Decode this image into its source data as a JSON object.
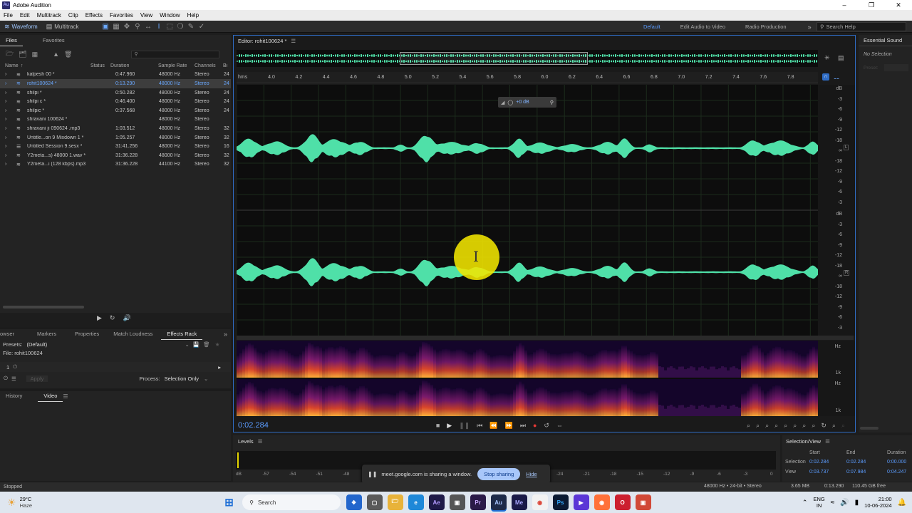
{
  "window": {
    "title": "Adobe Audition",
    "app_icon": "Au"
  },
  "menu": [
    "File",
    "Edit",
    "Multitrack",
    "Clip",
    "Effects",
    "Favorites",
    "View",
    "Window",
    "Help"
  ],
  "toolbar": {
    "waveform": "Waveform",
    "multitrack": "Multitrack",
    "workspaces": [
      "Default",
      "Edit Audio to Video",
      "Radio Production"
    ],
    "search_placeholder": "Search Help"
  },
  "files_panel": {
    "tabs": [
      "Files",
      "Favorites"
    ],
    "columns": [
      "Name",
      "Status",
      "Duration",
      "Sample Rate",
      "Channels",
      "Bi"
    ],
    "rows": [
      {
        "name": "kalpesh 00 *",
        "duration": "0:47.960",
        "rate": "48000 Hz",
        "channels": "Stereo",
        "bits": "24",
        "type": "wave"
      },
      {
        "name": "rohit100624 *",
        "duration": "0:13.290",
        "rate": "48000 Hz",
        "channels": "Stereo",
        "bits": "24",
        "type": "wave",
        "selected": true
      },
      {
        "name": "shilpi *",
        "duration": "0:50.282",
        "rate": "48000 Hz",
        "channels": "Stereo",
        "bits": "24",
        "type": "wave"
      },
      {
        "name": "shilpi c *",
        "duration": "0:46.400",
        "rate": "48000 Hz",
        "channels": "Stereo",
        "bits": "24",
        "type": "wave"
      },
      {
        "name": "shilpic *",
        "duration": "0:37.568",
        "rate": "48000 Hz",
        "channels": "Stereo",
        "bits": "24",
        "type": "wave"
      },
      {
        "name": "shravani 100624 *",
        "duration": "",
        "rate": "48000 Hz",
        "channels": "Stereo",
        "bits": "",
        "type": "wave"
      },
      {
        "name": "shravani ji 090624 .mp3",
        "duration": "1:03.512",
        "rate": "48000 Hz",
        "channels": "Stereo",
        "bits": "32",
        "type": "wave"
      },
      {
        "name": "Untitle...on 9 Mixdown 1 *",
        "duration": "1:05.257",
        "rate": "48000 Hz",
        "channels": "Stereo",
        "bits": "32",
        "type": "wave"
      },
      {
        "name": "Untitled Session 9.sesx *",
        "duration": "31:41.256",
        "rate": "48000 Hz",
        "channels": "Stereo",
        "bits": "16",
        "type": "session"
      },
      {
        "name": "Y2meta...s) 48000 1.wav *",
        "duration": "31:36.228",
        "rate": "48000 Hz",
        "channels": "Stereo",
        "bits": "32",
        "type": "wave"
      },
      {
        "name": "Y2meta...i (128 kbps).mp3",
        "duration": "31:36.228",
        "rate": "44100 Hz",
        "channels": "Stereo",
        "bits": "32",
        "type": "wave"
      }
    ]
  },
  "lower_panel": {
    "tabs": [
      "owser",
      "Markers",
      "Properties",
      "Match Loudness",
      "Effects Rack"
    ],
    "presets_label": "Presets:",
    "presets_value": "(Default)",
    "file_label": "File: rohit100624",
    "slot_number": "1",
    "apply": "Apply",
    "process_label": "Process:",
    "process_value": "Selection Only"
  },
  "history_panel": {
    "tabs": [
      "History",
      "Video"
    ]
  },
  "editor": {
    "title": "Editor: rohit100624 *",
    "ruler_unit": "hms",
    "ruler_ticks": [
      "4.0",
      "4.2",
      "4.4",
      "4.6",
      "4.8",
      "5.0",
      "5.2",
      "5.4",
      "5.6",
      "5.8",
      "6.0",
      "6.2",
      "6.4",
      "6.6",
      "6.8",
      "7.0",
      "7.2",
      "7.4",
      "7.6",
      "7.8"
    ],
    "db_labels": [
      "dB",
      "-3",
      "-6",
      "-9",
      "-12",
      "-18",
      "∞",
      "-18",
      "-12",
      "-9",
      "-6",
      "-3"
    ],
    "hz_labels": [
      "Hz",
      "1k"
    ],
    "channel_left": "L",
    "channel_right": "R",
    "hud_gain": "+0 dB",
    "current_time": "0:02.284"
  },
  "essential_sound": {
    "title": "Essential Sound",
    "status": "No Selection",
    "preset_label": "Preset:"
  },
  "levels": {
    "title": "Levels",
    "scale": [
      "dB",
      "-57",
      "-54",
      "-51",
      "-48",
      "-45",
      "-42",
      "-39",
      "-36",
      "-33",
      "-30",
      "-27",
      "-24",
      "-21",
      "-18",
      "-15",
      "-12",
      "-9",
      "-6",
      "-3",
      "0"
    ]
  },
  "selection_view": {
    "title": "Selection/View",
    "headers": [
      "Start",
      "End",
      "Duration"
    ],
    "selection": {
      "label": "Selection",
      "start": "0:02.284",
      "end": "0:02.284",
      "duration": "0:00.000"
    },
    "view": {
      "label": "View",
      "start": "0:03.737",
      "end": "0:07.984",
      "duration": "0:04.247"
    }
  },
  "share_bar": {
    "message": "meet.google.com is sharing a window.",
    "stop": "Stop sharing",
    "hide": "Hide"
  },
  "status_bar": {
    "left": "Stopped",
    "format": "48000 Hz • 24-bit • Stereo",
    "size": "3.65 MB",
    "duration": "0:13.290",
    "free": "110.45 GB free"
  },
  "taskbar": {
    "weather_temp": "29°C",
    "weather_desc": "Haze",
    "search": "Search",
    "lang": "ENG",
    "region": "IN",
    "time": "21:00",
    "date": "10-06-2024"
  },
  "colors": {
    "waveform": "#4fe0a8",
    "accent": "#2f6cc4",
    "selection_text": "#6aa8ff",
    "playhead_cursor": "#f2e600"
  }
}
